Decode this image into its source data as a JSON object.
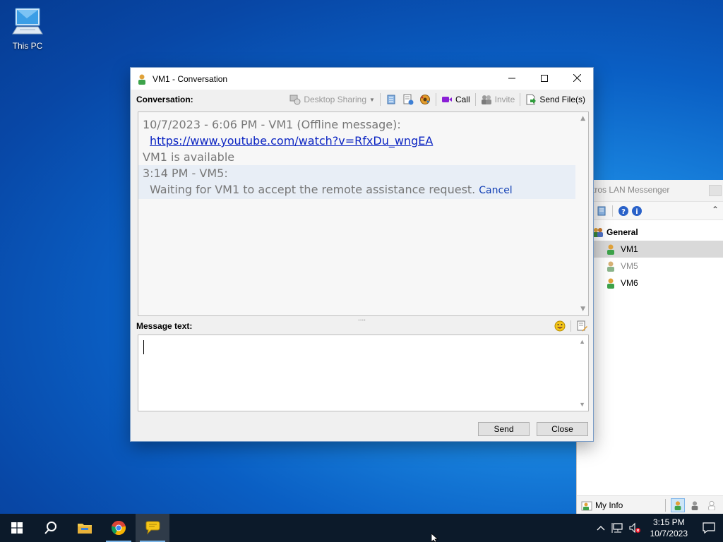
{
  "desktop": {
    "icons": [
      {
        "label": "This PC",
        "icon": "computer-icon"
      }
    ]
  },
  "conversation_window": {
    "title": "VM1 - Conversation",
    "conversation_label": "Conversation:",
    "toolbar": {
      "desktop_sharing": "Desktop Sharing",
      "call": "Call",
      "invite": "Invite",
      "send_files": "Send File(s)"
    },
    "history": {
      "line1": "10/7/2023 - 6:06 PM - VM1 (Offline message):",
      "link": "https://www.youtube.com/watch?v=RfxDu_wngEA",
      "line3": "VM1 is available",
      "line4": "3:14 PM - VM5:",
      "line5": "Waiting for VM1 to accept the remote assistance request.",
      "cancel": "Cancel"
    },
    "message_label": "Message text:",
    "message_value": "",
    "buttons": {
      "send": "Send",
      "close": "Close"
    },
    "splitter": "...."
  },
  "main_window": {
    "title": "tros LAN Messenger",
    "group": "General",
    "contacts": [
      {
        "name": "VM1",
        "status": "available",
        "selected": true
      },
      {
        "name": "VM5",
        "status": "away",
        "selected": false
      },
      {
        "name": "VM6",
        "status": "available",
        "selected": false
      }
    ],
    "my_info": "My Info"
  },
  "taskbar": {
    "apps": [
      "start-icon",
      "search-icon",
      "file-explorer-icon",
      "chrome-icon",
      "lan-messenger-icon"
    ],
    "clock_time": "3:15 PM",
    "clock_date": "10/7/2023"
  },
  "colors": {
    "link": "#0b24c2",
    "cancel": "#1340b5",
    "history_bg": "#f7f7f7",
    "taskbar": "#0c1a2a",
    "video_call": "#8a1fd6"
  }
}
